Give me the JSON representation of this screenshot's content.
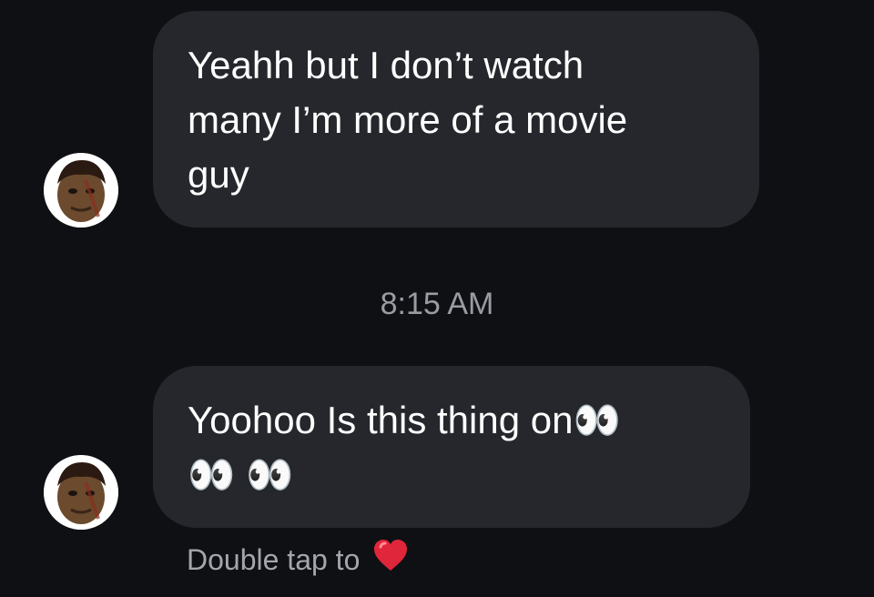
{
  "messages": [
    {
      "sender": "them",
      "lines": [
        "Yeahh but I don’t watch",
        "many I’m more of a movie",
        "guy"
      ]
    },
    {
      "sender": "them",
      "lines": [
        "Yoohoo Is this thing on👀",
        "👀 👀"
      ]
    }
  ],
  "timestamp": "8:15 AM",
  "footer": {
    "text": "Double tap to",
    "icon": "heart-icon",
    "icon_glyph": "❤️"
  },
  "colors": {
    "background": "#0f1014",
    "bubble": "#25272c",
    "text": "#ffffff",
    "meta": "#9a9ca3"
  }
}
